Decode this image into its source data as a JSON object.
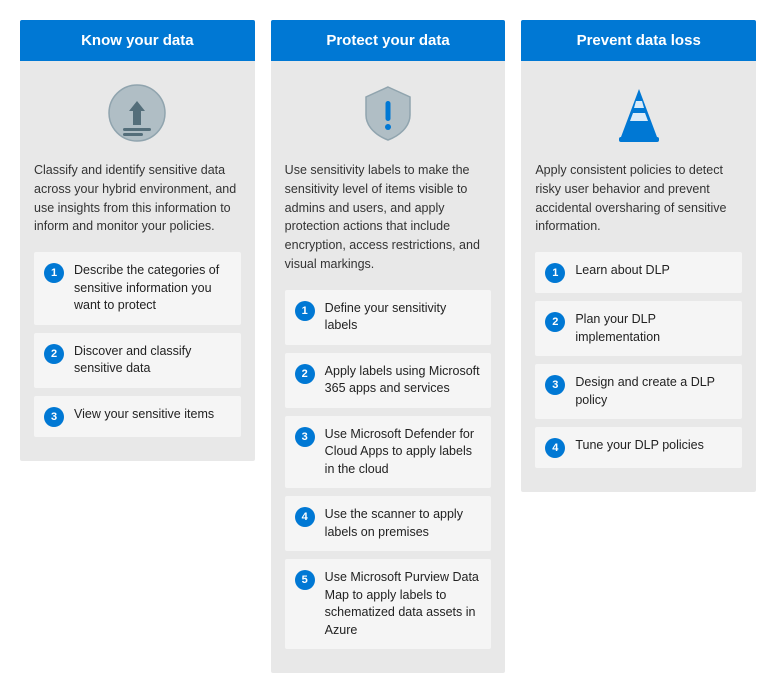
{
  "columns": [
    {
      "id": "know",
      "header": "Know your data",
      "description": "Classify and identify sensitive data across your hybrid environment, and use insights from this information to inform and monitor your policies.",
      "steps": [
        "Describe the categories of sensitive information you want to protect",
        "Discover and classify sensitive data",
        "View your sensitive items"
      ]
    },
    {
      "id": "protect",
      "header": "Protect your data",
      "description": "Use sensitivity labels to make the sensitivity level of items visible to admins and users, and apply protection actions that include encryption, access restrictions, and visual markings.",
      "steps": [
        "Define your sensitivity labels",
        "Apply labels using Microsoft 365 apps and services",
        "Use Microsoft Defender for Cloud Apps to apply labels in the cloud",
        "Use the scanner to apply labels on premises",
        "Use Microsoft Purview Data Map to apply labels to schematized data assets in Azure"
      ]
    },
    {
      "id": "prevent",
      "header": "Prevent data loss",
      "description": "Apply consistent policies to detect risky user behavior and prevent accidental oversharing of sensitive information.",
      "steps": [
        "Learn about DLP",
        "Plan your DLP implementation",
        "Design and create a DLP policy",
        "Tune your DLP policies"
      ]
    }
  ]
}
